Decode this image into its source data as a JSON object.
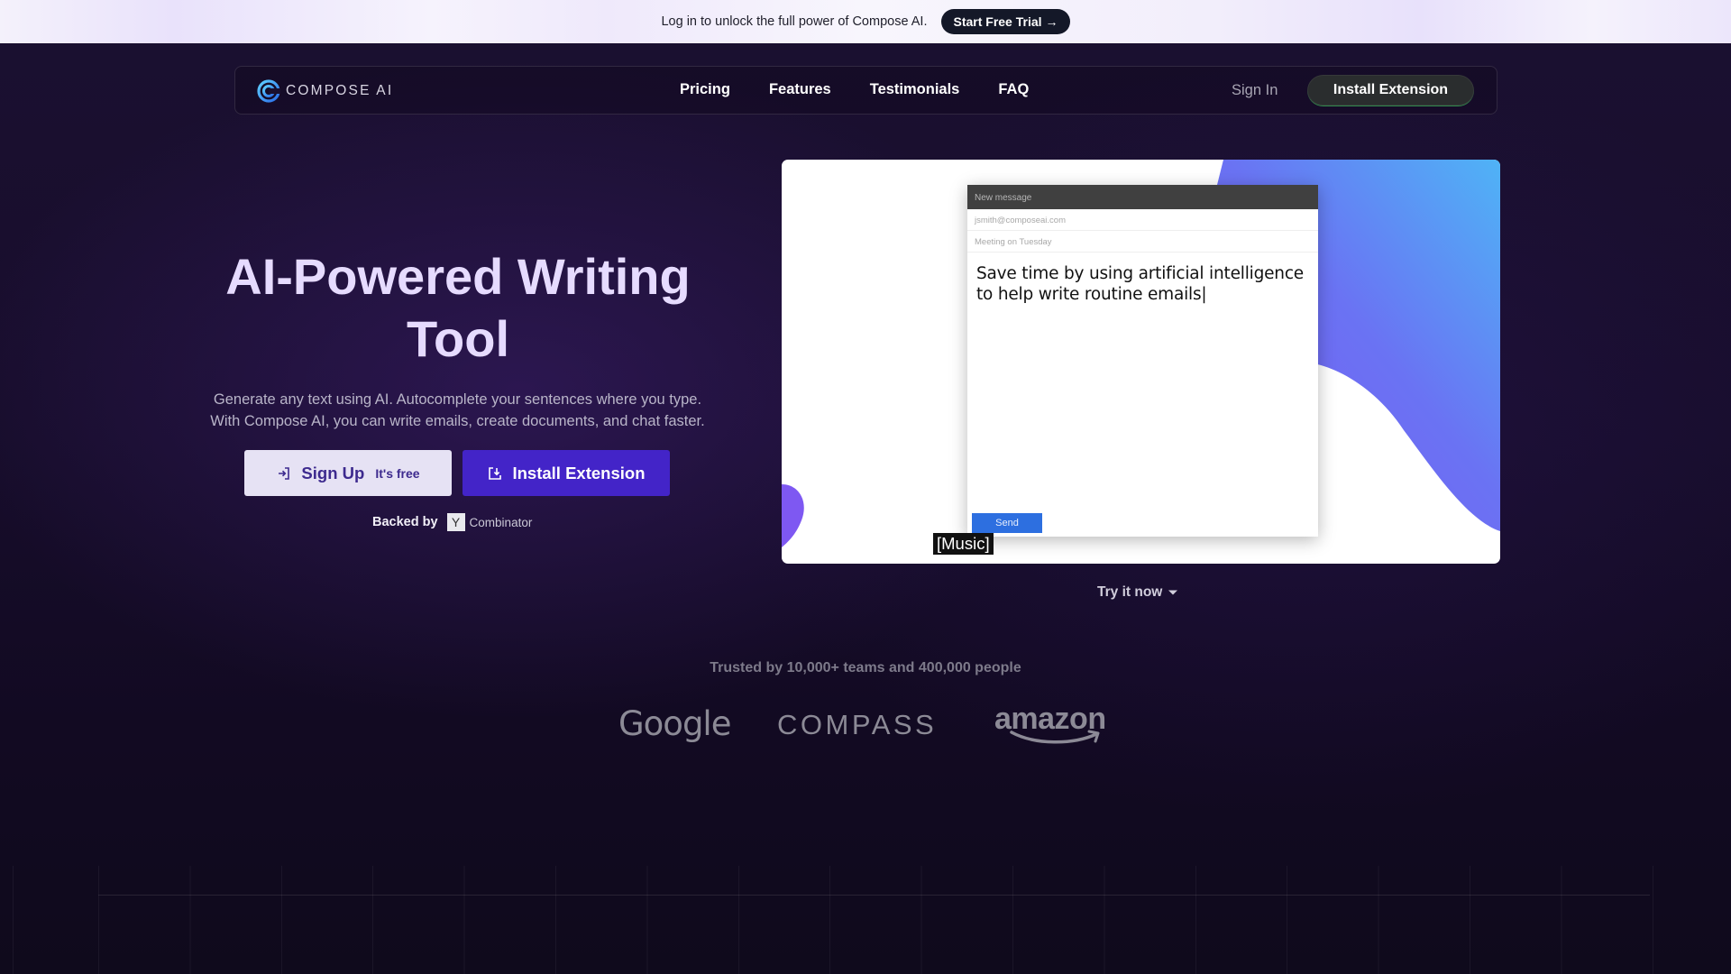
{
  "announcement": {
    "text": "Log in to unlock the full power of Compose AI.",
    "cta": "Start Free Trial",
    "cta_icon": "arrow-right-icon"
  },
  "nav": {
    "brand": "COMPOSE AI",
    "links": [
      "Pricing",
      "Features",
      "Testimonials",
      "FAQ"
    ],
    "sign_in": "Sign In",
    "install": "Install Extension"
  },
  "hero": {
    "title": "AI-Powered Writing Tool",
    "subtitle_line1": "Generate any text using AI. Autocomplete your sentences where you type.",
    "subtitle_line2": "With Compose AI, you can write emails, create documents, and chat faster.",
    "signup_label": "Sign Up",
    "signup_note": "It's free",
    "install_label": "Install Extension",
    "backed_by": "Backed by",
    "backer_letter": "Y",
    "backer_name": "Combinator"
  },
  "video": {
    "email_header": "New message",
    "email_to": "jsmith@composeai.com",
    "email_subject": "Meeting on Tuesday",
    "email_body": "Save time by using artificial intelligence to help write routine emails|",
    "send_label": "Send",
    "caption": "[Music]",
    "try_label": "Try it now"
  },
  "trusted": {
    "text": "Trusted by 10,000+ teams and 400,000 people",
    "logos": [
      "Google",
      "COMPASS",
      "amazon"
    ]
  },
  "colors": {
    "background": "#150c26",
    "title": "#e6dbff",
    "primary_button": "#4324c8",
    "secondary_button": "#e6e2f4",
    "accent_gradient_start": "#7a5af8",
    "accent_gradient_end": "#4fb3f6"
  }
}
